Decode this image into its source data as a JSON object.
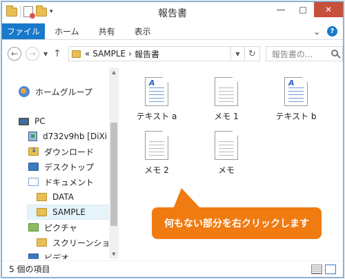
{
  "window": {
    "title": "報告書"
  },
  "ribbon": {
    "file_label": "ファイル",
    "tabs": [
      "ホーム",
      "共有",
      "表示"
    ]
  },
  "address": {
    "path_prefix": "«",
    "path": [
      "SAMPLE",
      "報告書"
    ],
    "separator": "›",
    "search_placeholder": "報告書の..."
  },
  "nav": {
    "items": [
      {
        "label": "ホームグループ",
        "icon": "homegroup-icon"
      },
      {
        "label": "PC",
        "icon": "pc-icon"
      },
      {
        "label": "d732v9hb [DiXi",
        "icon": "network-drive-icon"
      },
      {
        "label": "ダウンロード",
        "icon": "downloads-folder-icon"
      },
      {
        "label": "デスクトップ",
        "icon": "desktop-folder-icon"
      },
      {
        "label": "ドキュメント",
        "icon": "documents-folder-icon"
      },
      {
        "label": "DATA",
        "icon": "folder-icon"
      },
      {
        "label": "SAMPLE",
        "icon": "folder-icon",
        "selected": true
      },
      {
        "label": "ピクチャ",
        "icon": "pictures-folder-icon"
      },
      {
        "label": "スクリーンショット",
        "icon": "folder-icon"
      },
      {
        "label": "ビデオ",
        "icon": "videos-folder-icon"
      }
    ]
  },
  "files": [
    {
      "label": "テキスト a",
      "icon": "rich-text-document-icon"
    },
    {
      "label": "メモ 1",
      "icon": "text-document-icon"
    },
    {
      "label": "テキスト b",
      "icon": "rich-text-document-icon"
    },
    {
      "label": "メモ 2",
      "icon": "text-document-icon"
    },
    {
      "label": "メモ",
      "icon": "text-document-icon"
    }
  ],
  "callout": {
    "text": "何もない部分を右クリックします",
    "color": "#f07b11"
  },
  "status": {
    "item_count": "5 個の項目"
  },
  "colors": {
    "accent": "#1979ca",
    "close_button": "#c7503c"
  }
}
